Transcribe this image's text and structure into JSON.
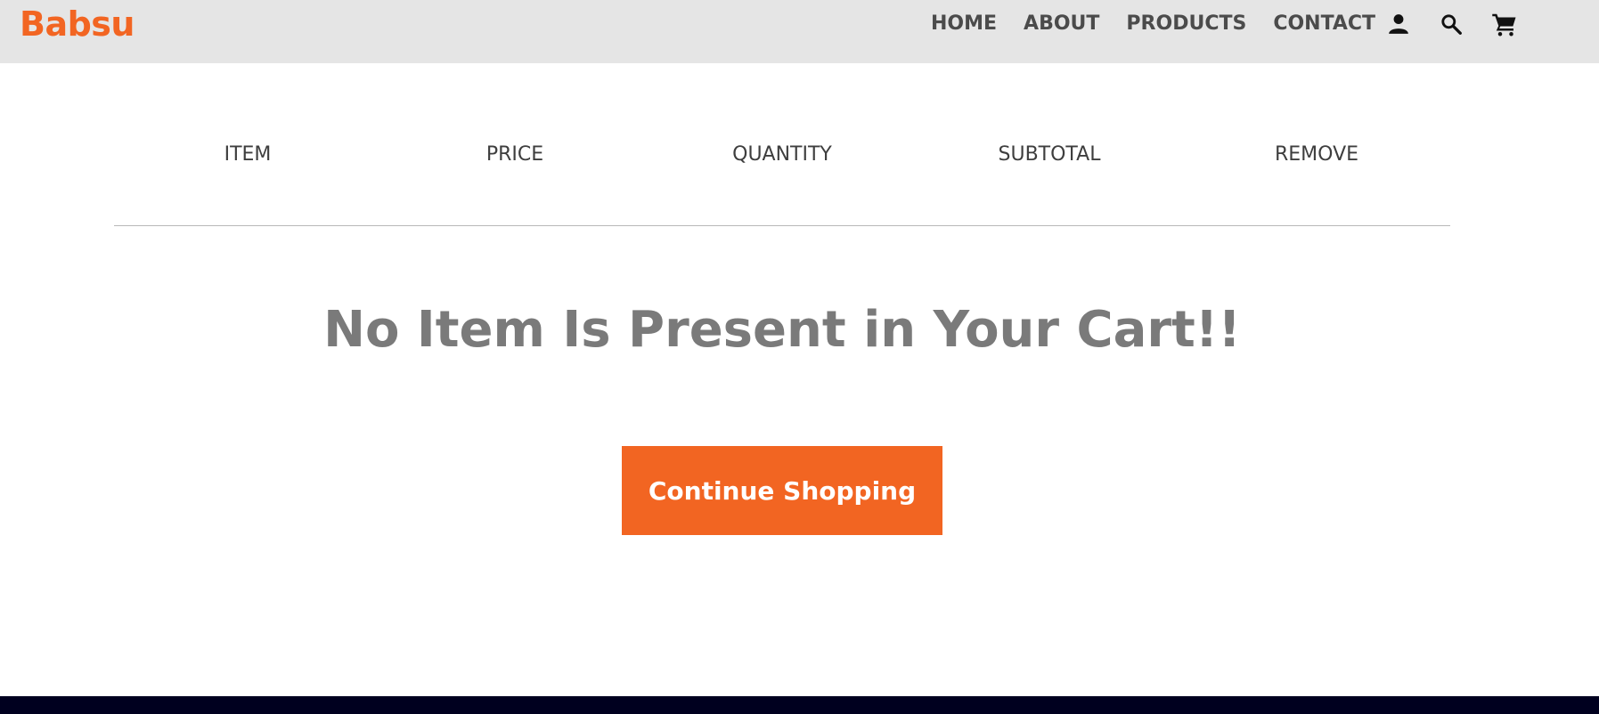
{
  "brand": {
    "name": "Babsu"
  },
  "nav": {
    "links": [
      {
        "label": "HOME"
      },
      {
        "label": "ABOUT"
      },
      {
        "label": "PRODUCTS"
      },
      {
        "label": "CONTACT"
      }
    ],
    "icons": [
      "user-icon",
      "search-icon",
      "cart-icon"
    ]
  },
  "cart": {
    "columns": [
      "ITEM",
      "PRICE",
      "QUANTITY",
      "SUBTOTAL",
      "REMOVE"
    ],
    "empty_message": "No Item Is Present in Your Cart!!",
    "continue_label": "Continue Shopping"
  },
  "colors": {
    "accent": "#f26522",
    "navbar_bg": "#e5e5e5",
    "footer_bg": "#00001f",
    "heading_text": "#7a7a7a"
  }
}
